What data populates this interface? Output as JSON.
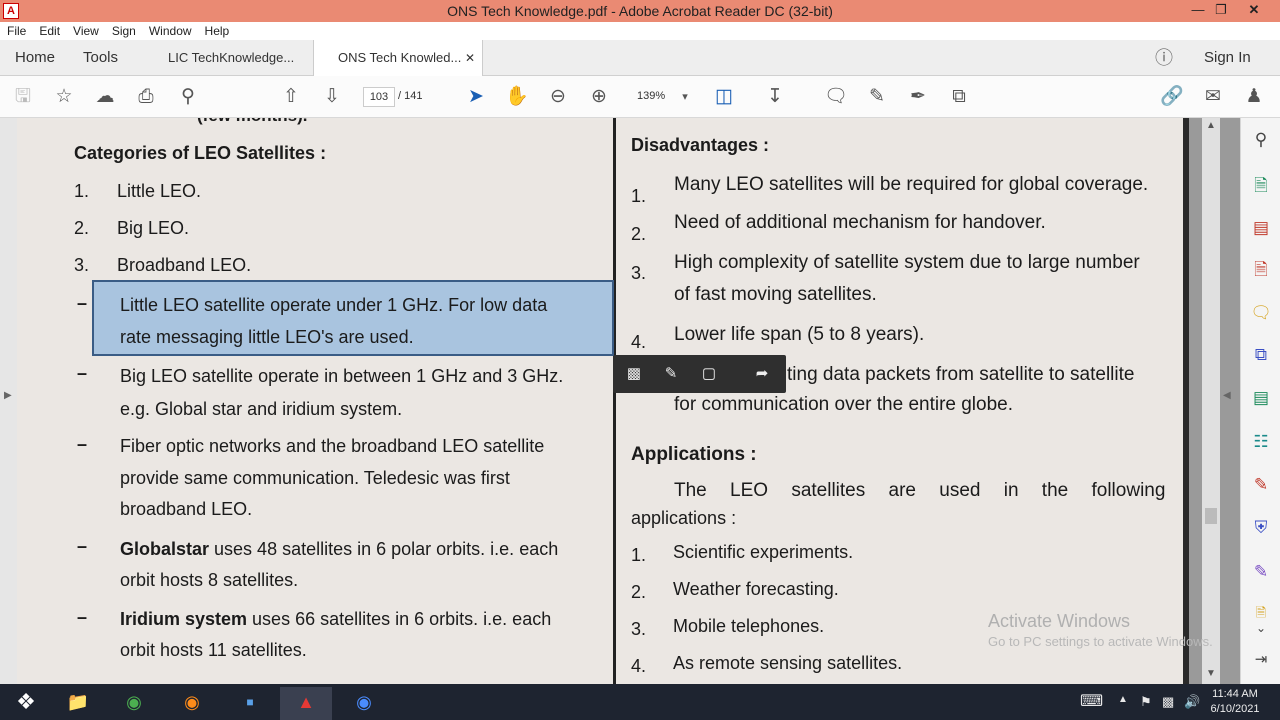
{
  "window": {
    "title": "ONS Tech Knowledge.pdf - Adobe Acrobat Reader DC (32-bit)"
  },
  "menu": [
    "File",
    "Edit",
    "View",
    "Sign",
    "Window",
    "Help"
  ],
  "tabs": {
    "home": "Home",
    "tools": "Tools",
    "doc1": "LIC TechKnowledge...",
    "doc2": "ONS Tech Knowled...",
    "sign_in": "Sign In"
  },
  "toolbar": {
    "page_current": "103",
    "page_total": "/ 141",
    "zoom": "139%"
  },
  "left_column": {
    "cut_line": "(few months).",
    "heading": "Categories of LEO Satellites :",
    "items": [
      {
        "num": "1.",
        "text": "Little LEO."
      },
      {
        "num": "2.",
        "text": "Big LEO."
      },
      {
        "num": "3.",
        "text": "Broadband LEO."
      }
    ],
    "bullets": [
      {
        "dash": "–",
        "lines": [
          "Little LEO satellite operate under 1 GHz. For low data",
          "rate messaging little LEO's are used."
        ]
      },
      {
        "dash": "–",
        "lines": [
          "Big LEO satellite operate in between 1 GHz and 3 GHz.",
          "e.g. Global star and iridium system."
        ]
      },
      {
        "dash": "–",
        "lines": [
          "Fiber optic networks and the broadband LEO satellite",
          "provide same communication. Teledesic was first",
          "broadband LEO."
        ]
      },
      {
        "dash": "–",
        "bold": "Globalstar",
        "lines": [
          " uses 48 satellites in 6 polar orbits. i.e. each",
          "orbit hosts 8 satellites."
        ]
      },
      {
        "dash": "–",
        "bold": "Iridium system",
        "lines": [
          " uses 66 satellites in 6 orbits. i.e. each",
          "orbit hosts 11 satellites."
        ]
      }
    ]
  },
  "right_column": {
    "disadv_heading": "Disadvantages :",
    "disadv": [
      {
        "num": "1.",
        "lines": [
          "Many LEO satellites will be required for global coverage."
        ]
      },
      {
        "num": "2.",
        "lines": [
          "Need of additional mechanism for handover."
        ]
      },
      {
        "num": "3.",
        "lines": [
          "High complexity of satellite system due to large number",
          "of fast moving satellites."
        ]
      },
      {
        "num": "4.",
        "lines": [
          "Lower life span (5 to 8 years)."
        ]
      },
      {
        "num": "",
        "lines": [
          "ting data packets from satellite to satellite",
          "for communication over the entire globe."
        ]
      }
    ],
    "app_heading": "Applications :",
    "app_intro": [
      "The LEO satellites are used in the following",
      "applications :"
    ],
    "apps": [
      {
        "num": "1.",
        "text": "Scientific experiments."
      },
      {
        "num": "2.",
        "text": "Weather forecasting."
      },
      {
        "num": "3.",
        "text": "Mobile telephones."
      },
      {
        "num": "4.",
        "text": "As remote sensing satellites."
      }
    ]
  },
  "watermark": {
    "line1": "Activate Windows",
    "line2": "Go to PC settings to activate Windows."
  },
  "clock": {
    "time": "11:44 AM",
    "date": "6/10/2021"
  },
  "colors": {
    "titlebar": "#ea8a73",
    "highlight": "#a9c4df",
    "taskbar": "#1e2430"
  }
}
